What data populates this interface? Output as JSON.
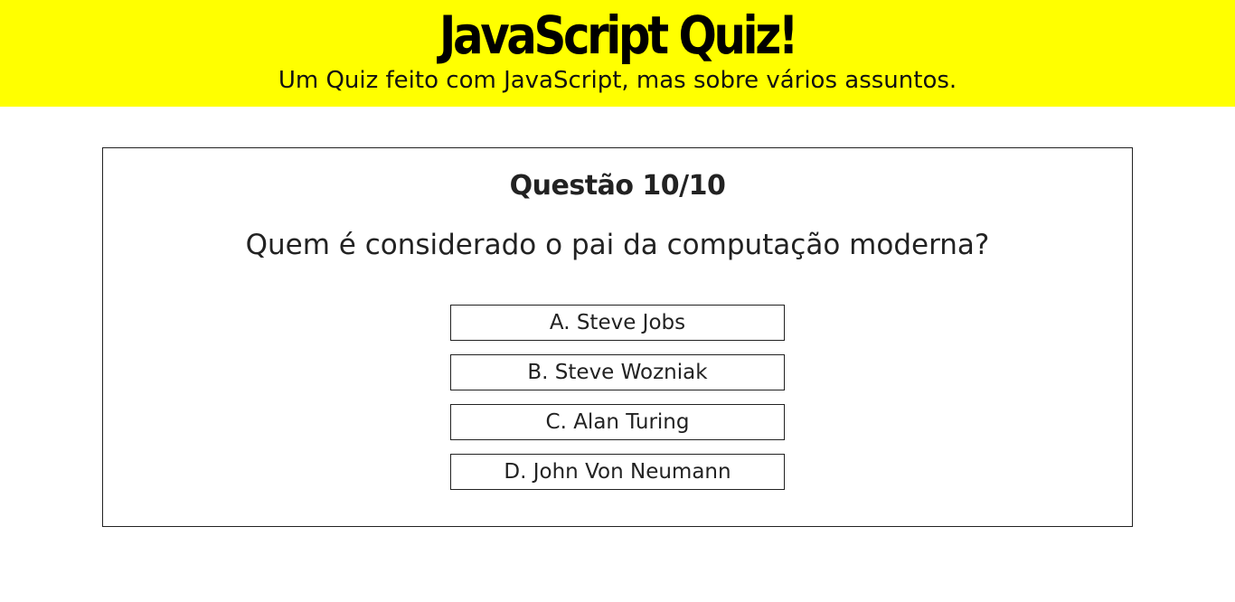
{
  "header": {
    "title": "JavaScript Quiz!",
    "subtitle": "Um Quiz feito com JavaScript, mas sobre vários assuntos.",
    "background_color": "#ffff00"
  },
  "quiz": {
    "counter": "Questão 10/10",
    "question": "Quem é considerado o pai da computação moderna?",
    "options": [
      {
        "label": "A. Steve Jobs"
      },
      {
        "label": "B. Steve Wozniak"
      },
      {
        "label": "C. Alan Turing"
      },
      {
        "label": "D. John Von Neumann"
      }
    ]
  }
}
